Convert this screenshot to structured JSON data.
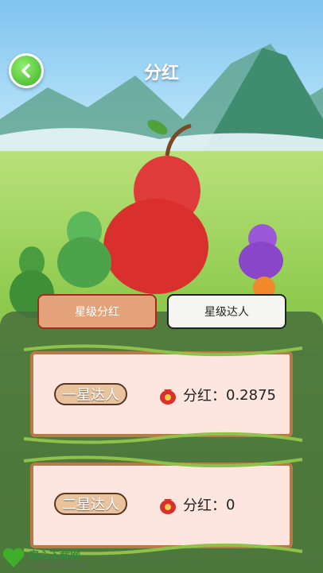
{
  "header": {
    "title": "分红"
  },
  "tabs": [
    {
      "label": "星级分红",
      "active": true
    },
    {
      "label": "星级达人",
      "active": false
    }
  ],
  "cards": [
    {
      "level_label": "一星达人",
      "bonus_label": "分红：",
      "bonus_value": "0.2875"
    },
    {
      "level_label": "二星达人",
      "bonus_label": "分红：",
      "bonus_value": "0"
    }
  ],
  "watermark": {
    "name": "安心下载网",
    "url": "www.java800.com"
  },
  "colors": {
    "tab_active_bg": "#e3a27a",
    "tab_active_border": "#a52a1e",
    "card_bg": "#fde6e0",
    "badge_bg": "#e9c39e",
    "back_button": "#3fae2b"
  },
  "icons": [
    "back-arrow-icon",
    "money-bag-icon",
    "gourd-illustration"
  ]
}
